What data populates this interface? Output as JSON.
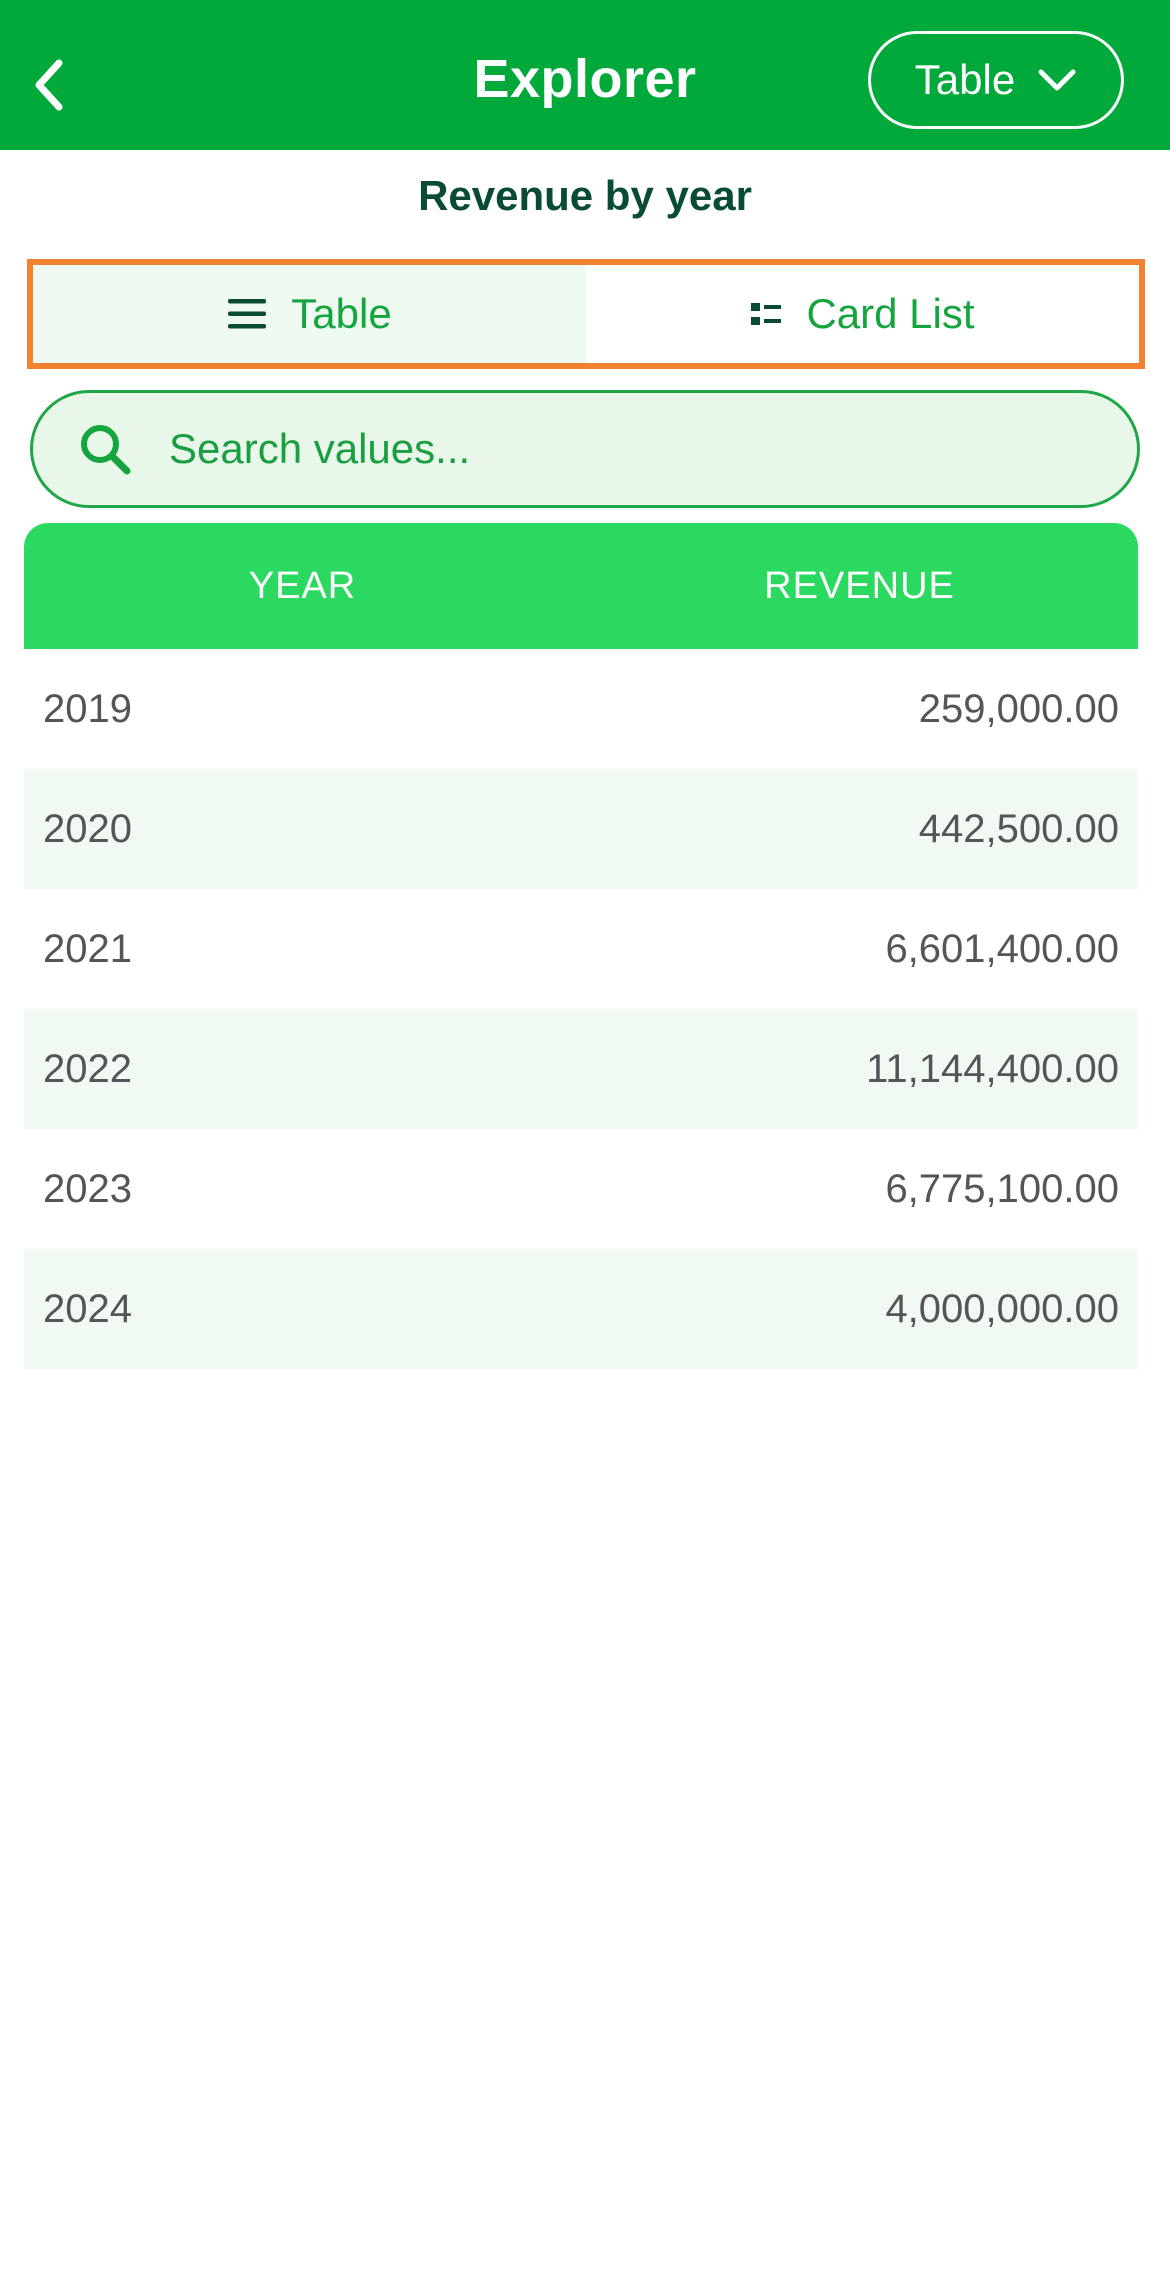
{
  "header": {
    "title": "Explorer",
    "view_dropdown_label": "Table"
  },
  "subtitle": "Revenue by year",
  "segment": {
    "table_label": "Table",
    "cardlist_label": "Card List"
  },
  "search": {
    "placeholder": "Search values..."
  },
  "table": {
    "columns": [
      "YEAR",
      "REVENUE"
    ],
    "rows": [
      {
        "year": "2019",
        "revenue": "259,000.00"
      },
      {
        "year": "2020",
        "revenue": "442,500.00"
      },
      {
        "year": "2021",
        "revenue": "6,601,400.00"
      },
      {
        "year": "2022",
        "revenue": "11,144,400.00"
      },
      {
        "year": "2023",
        "revenue": "6,775,100.00"
      },
      {
        "year": "2024",
        "revenue": "4,000,000.00"
      }
    ]
  },
  "colors": {
    "header_bg": "#00a93a",
    "table_header_bg": "#2bd960",
    "accent_text": "#14a53e",
    "highlight_border": "#f28130"
  }
}
